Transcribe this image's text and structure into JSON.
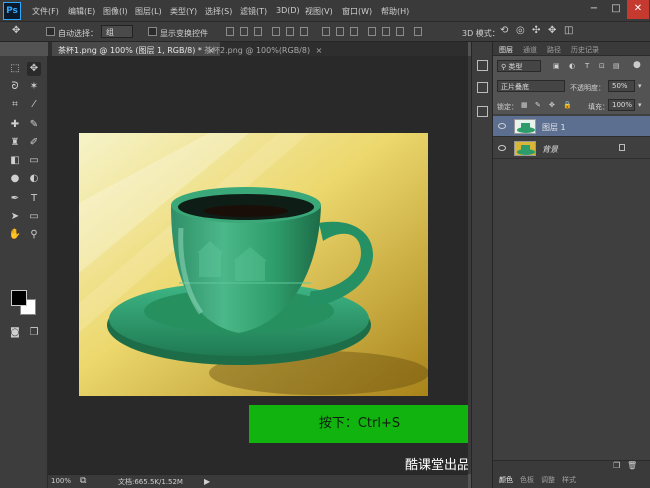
{
  "menubar": {
    "logo": "Ps",
    "items": [
      "文件(F)",
      "编辑(E)",
      "图像(I)",
      "图层(L)",
      "类型(Y)",
      "选择(S)",
      "滤镜(T)",
      "3D(D)",
      "视图(V)",
      "窗口(W)",
      "帮助(H)"
    ],
    "window_buttons": [
      "−",
      "□",
      "✕"
    ]
  },
  "options": {
    "auto_select_label": "自动选择：",
    "auto_select_value": "组",
    "show_transform_label": "显示变换控件",
    "mode_3d_label": "3D 模式："
  },
  "tabs": [
    {
      "label": "茶杯1.png @ 100% (图层 1, RGB/8) *",
      "close": "×"
    },
    {
      "label": "茶杯2.png @ 100%(RGB/8)",
      "close": "×"
    }
  ],
  "caption": "按下：Ctrl+S",
  "watermark": "酷课堂出品 coolketang.com",
  "status": {
    "zoom": "100%",
    "doc": "文档:665.5K/1.52M"
  },
  "layers_panel": {
    "tabs": [
      "图层",
      "通道",
      "路径",
      "历史记录"
    ],
    "filter_type": "类型",
    "blend_mode": "正片叠底",
    "opacity_label": "不透明度：",
    "opacity_value": "50%",
    "lock_label": "锁定：",
    "fill_label": "填充：",
    "fill_value": "100%",
    "layers": [
      {
        "name": "图层 1"
      },
      {
        "name": "背景"
      }
    ],
    "bottom_tabs": [
      "颜色",
      "色板",
      "调整",
      "样式"
    ]
  },
  "colors": {
    "caption_green": "#11b30f",
    "selected_layer": "#5d6f90",
    "cup_green": "#2e9c6a"
  }
}
